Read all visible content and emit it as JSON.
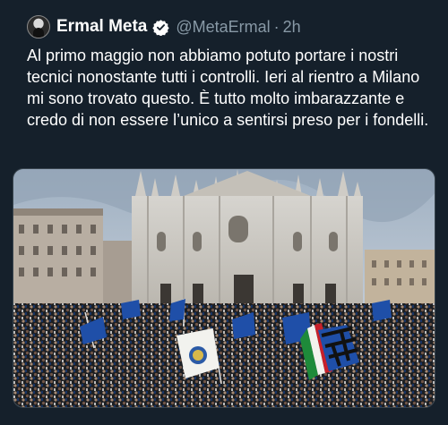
{
  "tweet": {
    "author_name": "Ermal Meta",
    "handle": "@MetaErmal",
    "separator": "·",
    "time": "2h",
    "text": "Al primo maggio non abbiamo potuto portare i nostri tecnici nonostante tutti i controlli. Ieri al rientro a Milano mi sono trovato questo. È tutto molto imbarazzante e credo di non essere l’unico a sentirsi preso per i fondelli.",
    "verified": true,
    "photo_alt": "Crowd with blue and black flags gathered in front of Milan Cathedral"
  },
  "colors": {
    "background": "#15202b",
    "text": "#ffffff",
    "secondary": "#8899a6",
    "verified_badge": "#ffffff",
    "flag_blue": "#1f4fa8",
    "italian_green": "#1e8a3a",
    "italian_red": "#c8202a"
  },
  "icons": {
    "verified": "verified-badge-icon",
    "avatar": "user-avatar"
  }
}
